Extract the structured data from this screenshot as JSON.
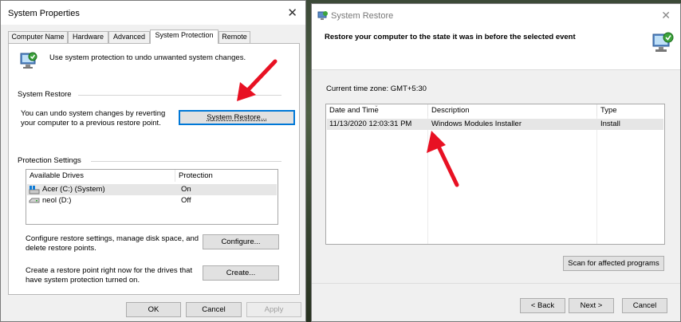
{
  "system_properties": {
    "title": "System Properties",
    "tabs": [
      {
        "label": "Computer Name"
      },
      {
        "label": "Hardware"
      },
      {
        "label": "Advanced"
      },
      {
        "label": "System Protection"
      },
      {
        "label": "Remote"
      }
    ],
    "intro_text": "Use system protection to undo unwanted system changes.",
    "system_restore": {
      "group_label": "System Restore",
      "description_line1": "You can undo system changes by reverting",
      "description_line2": "your computer to a previous restore point.",
      "button_label": "System Restore..."
    },
    "protection_settings": {
      "group_label": "Protection Settings",
      "columns": [
        "Available Drives",
        "Protection"
      ],
      "drives": [
        {
          "name": "Acer (C:) (System)",
          "protection": "On",
          "icon": "system-drive-icon"
        },
        {
          "name": "neol (D:)",
          "protection": "Off",
          "icon": "drive-icon"
        }
      ],
      "configure_text_line1": "Configure restore settings, manage disk space, and",
      "configure_text_line2": "delete restore points.",
      "configure_button": "Configure...",
      "create_text_line1": "Create a restore point right now for the drives that",
      "create_text_line2": "have system protection turned on.",
      "create_button": "Create..."
    },
    "footer": {
      "ok": "OK",
      "cancel": "Cancel",
      "apply": "Apply"
    }
  },
  "system_restore": {
    "title": "System Restore",
    "heading": "Restore your computer to the state it was in before the selected event",
    "timezone": "Current time zone: GMT+5:30",
    "columns": [
      "Date and Time",
      "Description",
      "Type"
    ],
    "points": [
      {
        "date": "11/13/2020 12:03:31 PM",
        "description": "Windows Modules Installer",
        "type": "Install"
      }
    ],
    "scan_button": "Scan for affected programs",
    "back_button": "< Back",
    "next_button": "Next >",
    "cancel_button": "Cancel"
  },
  "colors": {
    "annotation_arrow": "#e81123",
    "selection": "#e6e6e6",
    "focus": "#0078d7"
  }
}
